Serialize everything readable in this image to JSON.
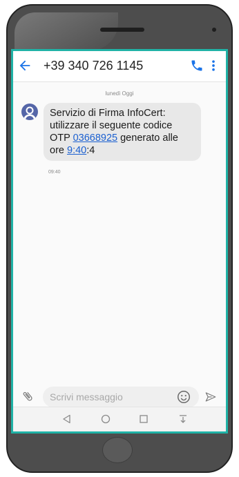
{
  "header": {
    "contact": "+39 340 726 1145"
  },
  "conversation": {
    "date_label": "lunedì Oggi",
    "message": {
      "text_part1": "Servizio di Firma InfoCert: utilizzare il seguente codice OTP ",
      "otp_link": "03668925",
      "text_part2": " generato alle ore ",
      "time_link": "9:40",
      "text_part3": ":4",
      "timestamp": "09:40"
    }
  },
  "composer": {
    "placeholder": "Scrivi messaggio"
  },
  "colors": {
    "accent": "#1a73e8",
    "screen_frame": "#20b2a6",
    "bubble": "#e8e8e8",
    "avatar": "#5566a8"
  },
  "icons": [
    "back-arrow-icon",
    "phone-icon",
    "more-vert-icon",
    "person-icon",
    "paperclip-icon",
    "emoji-icon",
    "send-icon",
    "nav-back-icon",
    "nav-home-icon",
    "nav-recents-icon",
    "nav-notification-icon"
  ]
}
